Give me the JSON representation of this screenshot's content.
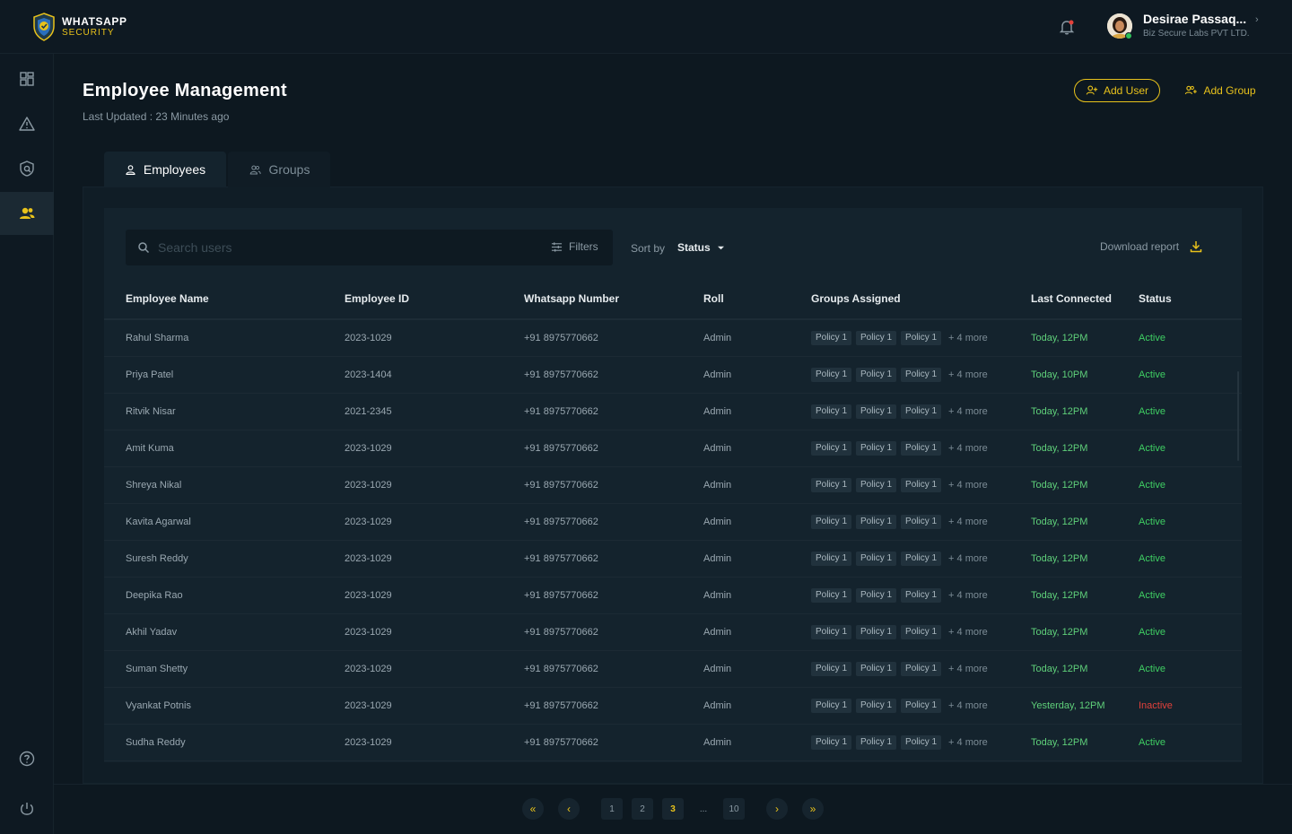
{
  "brand": {
    "line1": "WHATSAPP",
    "line2": "SECURITY"
  },
  "user": {
    "name": "Desirae Passaq...",
    "company": "Biz Secure Labs PVT LTD."
  },
  "sidebar": {
    "items": [
      {
        "name": "dashboard",
        "icon": "grid-icon"
      },
      {
        "name": "alerts",
        "icon": "warning-icon"
      },
      {
        "name": "security",
        "icon": "shield-icon"
      },
      {
        "name": "users",
        "icon": "users-icon",
        "active": true
      }
    ],
    "bottom": [
      {
        "name": "help",
        "icon": "help-icon"
      },
      {
        "name": "logout",
        "icon": "power-icon"
      }
    ]
  },
  "header": {
    "title": "Employee Management",
    "last_updated": "Last Updated  :  23 Minutes ago",
    "add_user": "Add User",
    "add_group": "Add Group"
  },
  "tabs": [
    {
      "label": "Employees",
      "active": true
    },
    {
      "label": "Groups",
      "active": false
    }
  ],
  "toolbar": {
    "search_placeholder": "Search users",
    "filters": "Filters",
    "sort_label": "Sort by",
    "sort_value": "Status",
    "download": "Download report"
  },
  "table": {
    "columns": [
      "Employee Name",
      "Employee ID",
      "Whatsapp Number",
      "Roll",
      "Groups Assigned",
      "Last Connected",
      "Status"
    ],
    "rows": [
      {
        "name": "Rahul Sharma",
        "id": "2023-1029",
        "phone": "+91 8975770662",
        "role": "Admin",
        "groups": [
          "Policy 1",
          "Policy 1",
          "Policy 1"
        ],
        "more": "+ 4 more",
        "last": "Today, 12PM",
        "status": "Active"
      },
      {
        "name": "Priya Patel",
        "id": "2023-1404",
        "phone": "+91 8975770662",
        "role": "Admin",
        "groups": [
          "Policy 1",
          "Policy 1",
          "Policy 1"
        ],
        "more": "+ 4 more",
        "last": "Today, 10PM",
        "status": "Active"
      },
      {
        "name": "Ritvik Nisar",
        "id": "2021-2345",
        "phone": "+91 8975770662",
        "role": "Admin",
        "groups": [
          "Policy 1",
          "Policy 1",
          "Policy 1"
        ],
        "more": "+ 4 more",
        "last": "Today, 12PM",
        "status": "Active"
      },
      {
        "name": "Amit Kuma",
        "id": "2023-1029",
        "phone": "+91 8975770662",
        "role": "Admin",
        "groups": [
          "Policy 1",
          "Policy 1",
          "Policy 1"
        ],
        "more": "+ 4 more",
        "last": "Today, 12PM",
        "status": "Active"
      },
      {
        "name": "Shreya  Nikal",
        "id": "2023-1029",
        "phone": "+91 8975770662",
        "role": "Admin",
        "groups": [
          "Policy 1",
          "Policy 1",
          "Policy 1"
        ],
        "more": "+ 4 more",
        "last": "Today, 12PM",
        "status": "Active"
      },
      {
        "name": "Kavita Agarwal",
        "id": "2023-1029",
        "phone": "+91 8975770662",
        "role": "Admin",
        "groups": [
          "Policy 1",
          "Policy 1",
          "Policy 1"
        ],
        "more": "+ 4 more",
        "last": "Today, 12PM",
        "status": "Active"
      },
      {
        "name": "Suresh Reddy",
        "id": "2023-1029",
        "phone": "+91 8975770662",
        "role": "Admin",
        "groups": [
          "Policy 1",
          "Policy 1",
          "Policy 1"
        ],
        "more": "+ 4 more",
        "last": "Today, 12PM",
        "status": "Active"
      },
      {
        "name": "Deepika Rao",
        "id": "2023-1029",
        "phone": "+91 8975770662",
        "role": "Admin",
        "groups": [
          "Policy 1",
          "Policy 1",
          "Policy 1"
        ],
        "more": "+ 4 more",
        "last": "Today, 12PM",
        "status": "Active"
      },
      {
        "name": "Akhil Yadav",
        "id": "2023-1029",
        "phone": "+91 8975770662",
        "role": "Admin",
        "groups": [
          "Policy 1",
          "Policy 1",
          "Policy 1"
        ],
        "more": "+ 4 more",
        "last": "Today, 12PM",
        "status": "Active"
      },
      {
        "name": "Suman Shetty",
        "id": "2023-1029",
        "phone": "+91 8975770662",
        "role": "Admin",
        "groups": [
          "Policy 1",
          "Policy 1",
          "Policy 1"
        ],
        "more": "+ 4 more",
        "last": "Today, 12PM",
        "status": "Active"
      },
      {
        "name": "Vyankat Potnis",
        "id": "2023-1029",
        "phone": "+91 8975770662",
        "role": "Admin",
        "groups": [
          "Policy 1",
          "Policy 1",
          "Policy 1"
        ],
        "more": "+ 4 more",
        "last": "Yesterday, 12PM",
        "status": "Inactive"
      },
      {
        "name": "Sudha Reddy",
        "id": "2023-1029",
        "phone": "+91 8975770662",
        "role": "Admin",
        "groups": [
          "Policy 1",
          "Policy 1",
          "Policy 1"
        ],
        "more": "+ 4 more",
        "last": "Today, 12PM",
        "status": "Active"
      }
    ]
  },
  "pagination": {
    "first": "«",
    "prev": "‹",
    "pages": [
      "1",
      "2",
      "3"
    ],
    "current": "3",
    "ellipsis": "...",
    "last_page": "10",
    "next": "›",
    "last": "»"
  },
  "colors": {
    "accent": "#e8c21b",
    "active": "#3fcf63",
    "inactive": "#e2413b",
    "background": "#0d1820"
  }
}
